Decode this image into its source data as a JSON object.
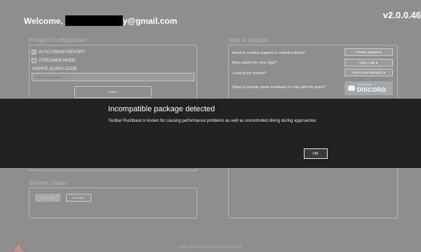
{
  "header": {
    "welcome_prefix": "Welcome,",
    "email_suffix": "y@gmail.com",
    "version": "v2.0.0.46"
  },
  "product_configuration": {
    "title": "Product Configuration",
    "auto_crash_report": {
      "label": "AUTO CRASH REPORT",
      "checked": true
    },
    "streamer_mode": {
      "label": "STREAMER MODE",
      "checked": false
    },
    "acars_label": "HOPPIE ACARS CODE",
    "login_placeholder": "Enter Logon Code",
    "apply_label": "APPLY"
  },
  "help_support": {
    "title": "Help & Support",
    "items": [
      {
        "question": "Need to contact support or submit a ticket?",
        "button": "Contact Support ⮞"
      },
      {
        "question": "Been asked for your logs?",
        "button": "Open Logs ⮞"
      },
      {
        "question": "Looking for liveries?",
        "button": "Fenix Livery Manager ⮞"
      }
    ],
    "feedback_question": "Want to provide some feedback or chat with the team?",
    "discord": {
      "small": "JOIN US ON",
      "big": "DISCORD"
    }
  },
  "system_status": {
    "title": "System Status",
    "primary_button": "RUNNING",
    "secondary_button": "LOG OUT"
  },
  "footer": "© 2024 FENIX SIM LTD. ALL RIGHTS RESERVED.",
  "modal": {
    "title": "Incompatible package detected",
    "body": "Toolbar Pushback is known for causing performance problems as well as uncontrolled diving during approaches",
    "ok_label": "OK"
  },
  "icons": {
    "check": "check-icon",
    "discord": "discord-icon",
    "brand": "fenix-logo"
  },
  "colors": {
    "background": "#8e8e8e",
    "modal_background": "#212121",
    "accent_text": "#ffffff"
  }
}
